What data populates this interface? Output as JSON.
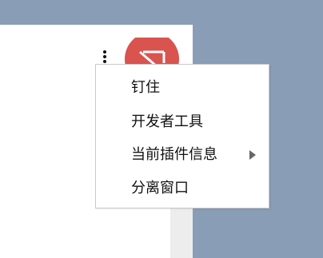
{
  "toolbar": {
    "more_icon": "more-vertical-icon",
    "extension_icon": "blocked-extension-icon"
  },
  "context_menu": {
    "items": [
      {
        "label": "钉住",
        "has_submenu": false
      },
      {
        "label": "开发者工具",
        "has_submenu": false
      },
      {
        "label": "当前插件信息",
        "has_submenu": true,
        "submenu_icon": "chevron-right-icon"
      },
      {
        "label": "分离窗口",
        "has_submenu": false
      }
    ]
  },
  "colors": {
    "desktop_background": "#8a9db7",
    "panel_background": "#ffffff",
    "extension_icon_red": "#d9534f"
  }
}
